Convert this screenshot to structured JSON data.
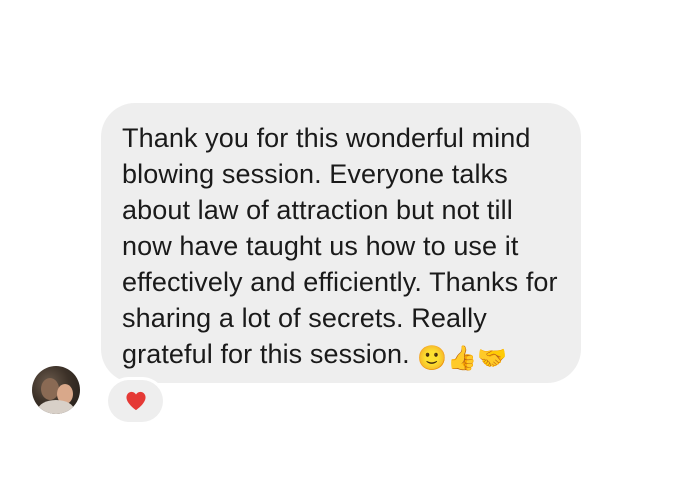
{
  "message": {
    "text": "Thank you for this wonderful mind blowing session. Everyone talks about law of attraction but not till now have taught us how to use it effectively and efficiently. Thanks for sharing a lot of secrets. Really grateful for this session.",
    "emojis": [
      {
        "name": "slightly-smiling-face",
        "glyph": "🙂"
      },
      {
        "name": "thumbs-up",
        "glyph": "👍"
      },
      {
        "name": "handshake",
        "glyph": "🤝"
      }
    ]
  },
  "reaction": {
    "icon": "red-heart-icon",
    "color": "#e53935"
  },
  "colors": {
    "bubble_background": "#eeeeee",
    "text": "#1a1a1a"
  }
}
